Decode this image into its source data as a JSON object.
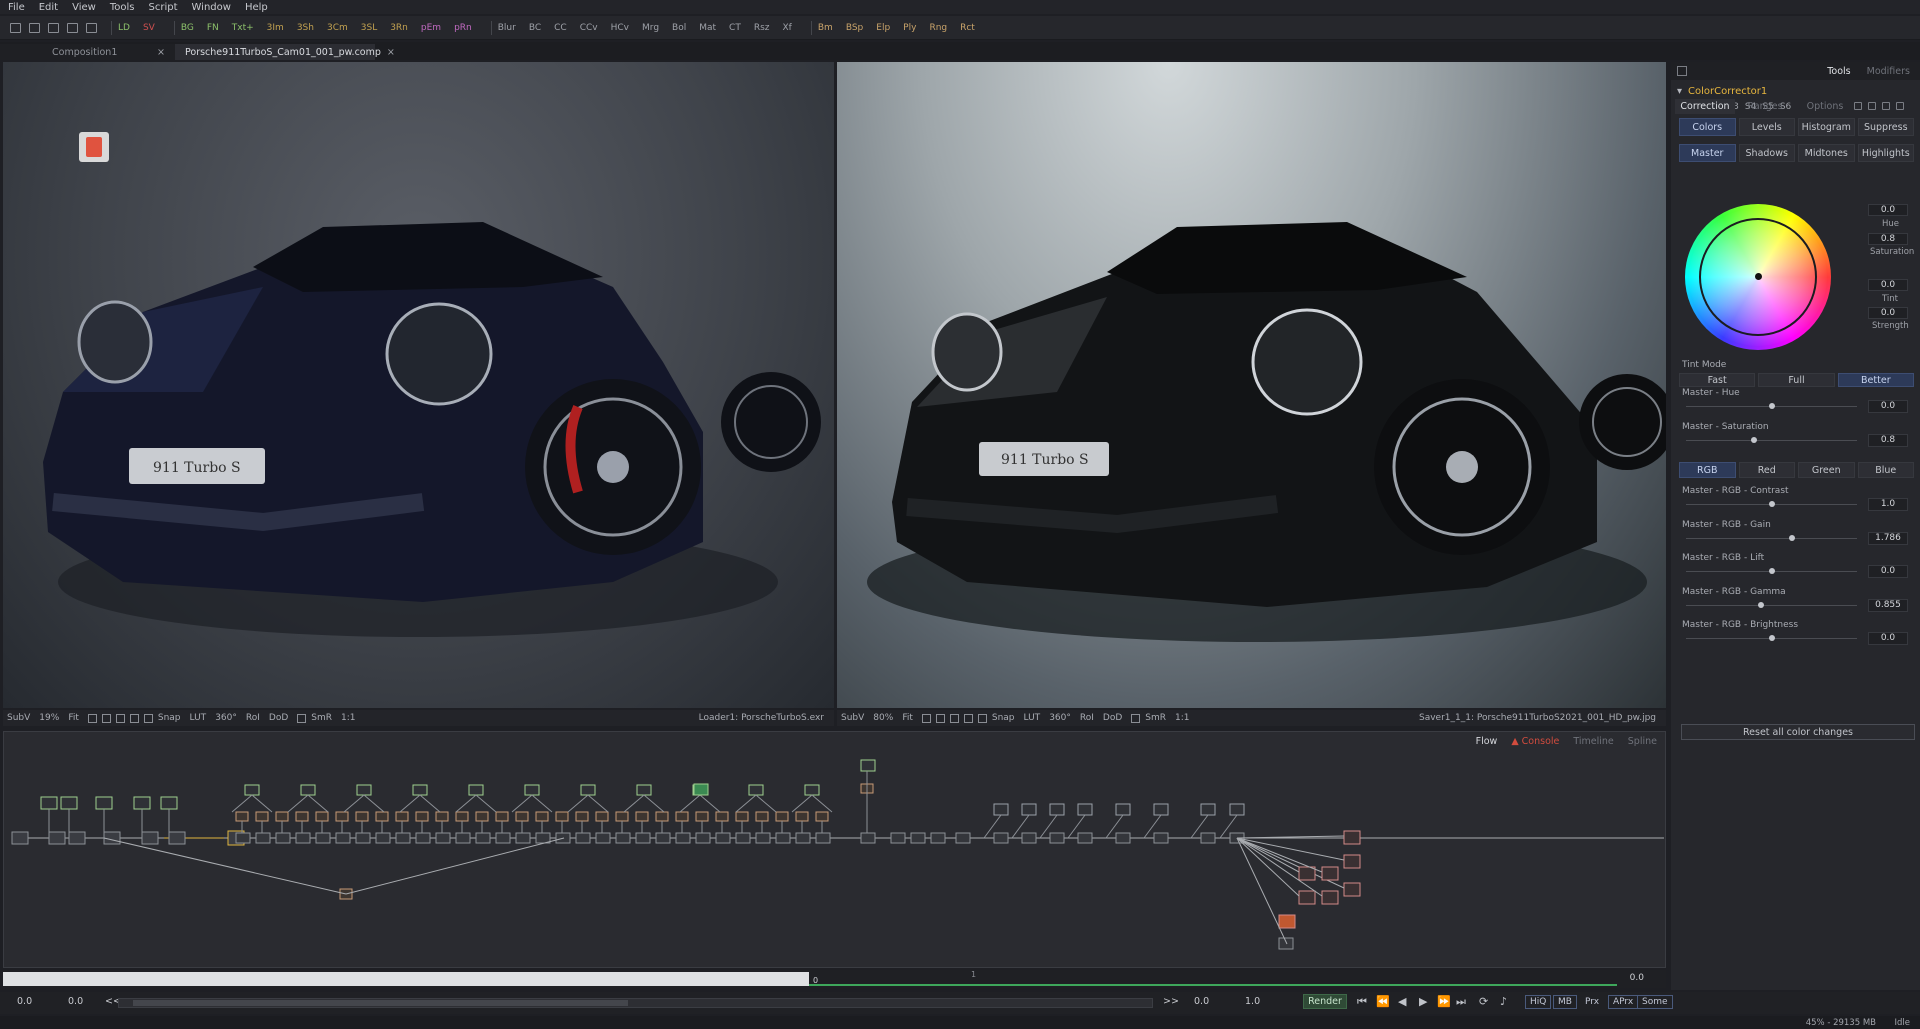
{
  "menu": [
    "File",
    "Edit",
    "View",
    "Tools",
    "Script",
    "Window",
    "Help"
  ],
  "toolbar": {
    "groups": [
      [
        {
          "label": "LD",
          "color": "#8cc06a"
        },
        {
          "label": "SV",
          "color": "#d05050"
        }
      ],
      [
        {
          "label": "BG",
          "color": "#8cc06a"
        },
        {
          "label": "FN",
          "color": "#8cc06a"
        },
        {
          "label": "Txt+",
          "color": "#8cc06a"
        },
        {
          "label": "3Im",
          "color": "#c0a050"
        },
        {
          "label": "3Sh",
          "color": "#c0a050"
        },
        {
          "label": "3Cm",
          "color": "#c0a050"
        },
        {
          "label": "3SL",
          "color": "#c0a050"
        },
        {
          "label": "3Rn",
          "color": "#c0a050"
        },
        {
          "label": "pEm",
          "color": "#c06ac0"
        },
        {
          "label": "pRn",
          "color": "#c06ac0"
        }
      ],
      [
        {
          "label": "Blur",
          "color": "#9ea1a8"
        },
        {
          "label": "BC",
          "color": "#9ea1a8"
        },
        {
          "label": "CC",
          "color": "#9ea1a8"
        },
        {
          "label": "CCv",
          "color": "#9ea1a8"
        },
        {
          "label": "HCv",
          "color": "#9ea1a8"
        },
        {
          "label": "Mrg",
          "color": "#9ea1a8"
        },
        {
          "label": "Bol",
          "color": "#9ea1a8"
        },
        {
          "label": "Mat",
          "color": "#9ea1a8"
        },
        {
          "label": "CT",
          "color": "#9ea1a8"
        },
        {
          "label": "Rsz",
          "color": "#9ea1a8"
        },
        {
          "label": "Xf",
          "color": "#9ea1a8"
        }
      ],
      [
        {
          "label": "Bm",
          "color": "#c8a36a"
        },
        {
          "label": "BSp",
          "color": "#c8a36a"
        },
        {
          "label": "Elp",
          "color": "#c8a36a"
        },
        {
          "label": "Ply",
          "color": "#c8a36a"
        },
        {
          "label": "Rng",
          "color": "#c8a36a"
        },
        {
          "label": "Rct",
          "color": "#c8a36a"
        }
      ]
    ]
  },
  "tabs": [
    {
      "label": "Composition1",
      "active": false
    },
    {
      "label": "Porsche911TurboS_Cam01_001_pw.comp",
      "active": true
    }
  ],
  "viewer_left": {
    "zoom": "19%",
    "fit": "Fit",
    "items": [
      "SubV",
      "19%",
      "Fit",
      "Snap",
      "LUT",
      "360°",
      "RoI",
      "DoD",
      "SmR",
      "1:1"
    ],
    "label": "Loader1: PorscheTurboS.exr"
  },
  "viewer_right": {
    "zoom": "80%",
    "fit": "Fit",
    "items": [
      "SubV",
      "80%",
      "Fit",
      "Snap",
      "LUT",
      "360°",
      "RoI",
      "DoD",
      "SmR",
      "1:1"
    ],
    "label": "Saver1_1_1: Porsche911TurboS2021_001_HD_pw.jpg"
  },
  "flow": {
    "tabs": [
      "Flow",
      "Console",
      "Timeline",
      "Spline"
    ],
    "active_tab": "Flow",
    "warn_tab": "Console"
  },
  "timeline": {
    "start": "0",
    "mid": "1",
    "end": "0.0"
  },
  "transport": {
    "field1": "0.0",
    "field2": "0.0",
    "back_label": "<<",
    "fwd_label": ">>",
    "field3": "0.0",
    "field4": "1.0",
    "render_label": "Render",
    "toggles": [
      "HiQ",
      "MB",
      "Prx",
      "APrx",
      "Some"
    ]
  },
  "status": {
    "memory": "45% - 29135 MB",
    "state": "Idle"
  },
  "inspector": {
    "header_tabs": [
      "Tools",
      "Modifiers"
    ],
    "tool_name": "ColorCorrector1",
    "slots": [
      "S1",
      "S2",
      "S3",
      "S4",
      "S5",
      "S6"
    ],
    "section_tabs": [
      "Correction",
      "Ranges",
      "Options"
    ],
    "mode_buttons": [
      "Colors",
      "Levels",
      "Histogram",
      "Suppress"
    ],
    "range_buttons": [
      "Master",
      "Shadows",
      "Midtones",
      "Highlights"
    ],
    "wheel": {
      "hue": "0.0",
      "hue_label": "Hue",
      "saturation": "0.8",
      "saturation_label": "Saturation",
      "tint": "0.0",
      "tint_label": "Tint",
      "strength": "0.0",
      "strength_label": "Strength"
    },
    "tint_mode_label": "Tint Mode",
    "tint_mode_options": [
      "Fast",
      "Full",
      "Better"
    ],
    "tint_mode_selected": "Better",
    "sliders_top": [
      {
        "label": "Master - Hue",
        "value": "0.0",
        "pos": 0.5
      },
      {
        "label": "Master - Saturation",
        "value": "0.8",
        "pos": 0.4
      }
    ],
    "channel_buttons": [
      "RGB",
      "Red",
      "Green",
      "Blue"
    ],
    "sliders_bottom": [
      {
        "label": "Master - RGB - Contrast",
        "value": "1.0",
        "pos": 0.5
      },
      {
        "label": "Master - RGB - Gain",
        "value": "1.786",
        "pos": 0.62
      },
      {
        "label": "Master - RGB - Lift",
        "value": "0.0",
        "pos": 0.5
      },
      {
        "label": "Master - RGB - Gamma",
        "value": "0.855",
        "pos": 0.44
      },
      {
        "label": "Master - RGB - Brightness",
        "value": "0.0",
        "pos": 0.5
      }
    ],
    "reset_label": "Reset all color changes"
  }
}
